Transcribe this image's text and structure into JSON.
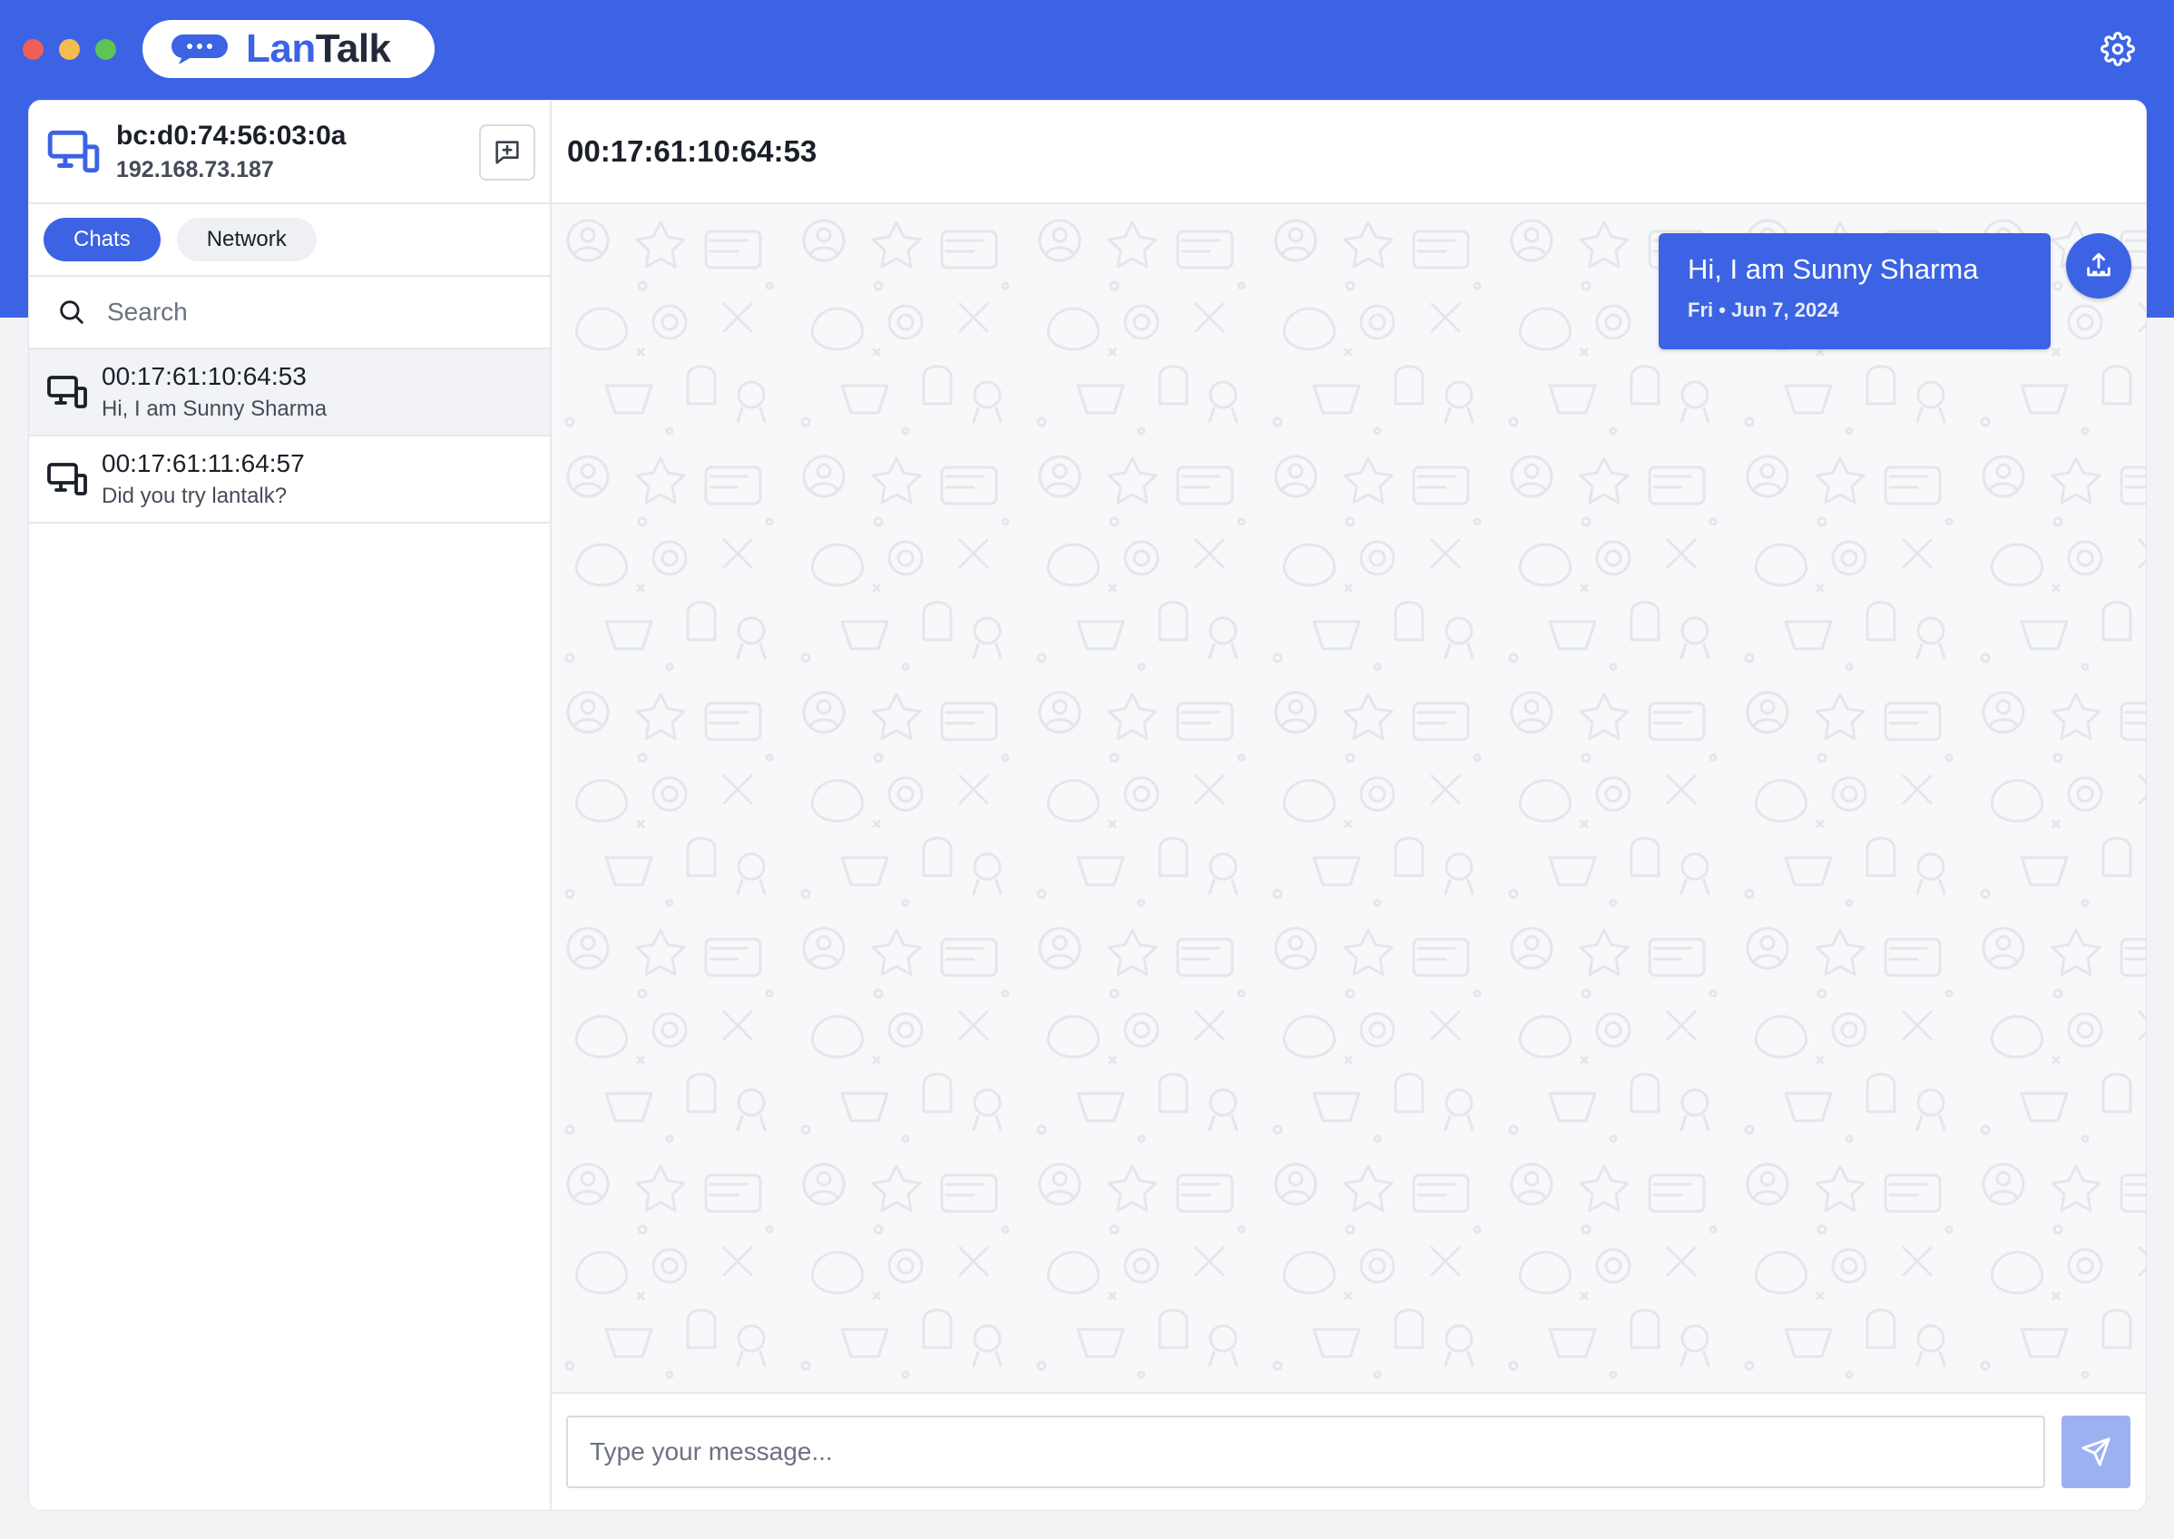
{
  "app": {
    "logo_part1": "Lan",
    "logo_part2": "Talk",
    "accent_color": "#3b63e4"
  },
  "me": {
    "id": "bc:d0:74:56:03:0a",
    "ip": "192.168.73.187"
  },
  "tabs": [
    {
      "label": "Chats",
      "active": true
    },
    {
      "label": "Network",
      "active": false
    }
  ],
  "search": {
    "placeholder": "Search",
    "value": ""
  },
  "chats": [
    {
      "name": "00:17:61:10:64:53",
      "preview": "Hi, I am Sunny Sharma",
      "selected": true
    },
    {
      "name": "00:17:61:11:64:57",
      "preview": "Did you try lantalk?",
      "selected": false
    }
  ],
  "conversation": {
    "title": "00:17:61:10:64:53",
    "messages": [
      {
        "text": "Hi, I am Sunny Sharma",
        "time": "Fri • Jun 7, 2024",
        "outgoing": true
      }
    ]
  },
  "composer": {
    "placeholder": "Type your message...",
    "value": ""
  },
  "icons": {
    "logo": "chat-bubble-icon",
    "settings": "gear-icon",
    "device": "devices-icon",
    "new_chat": "message-plus-icon",
    "search": "search-icon",
    "send": "send-icon",
    "sender": "upload-tray-icon"
  }
}
